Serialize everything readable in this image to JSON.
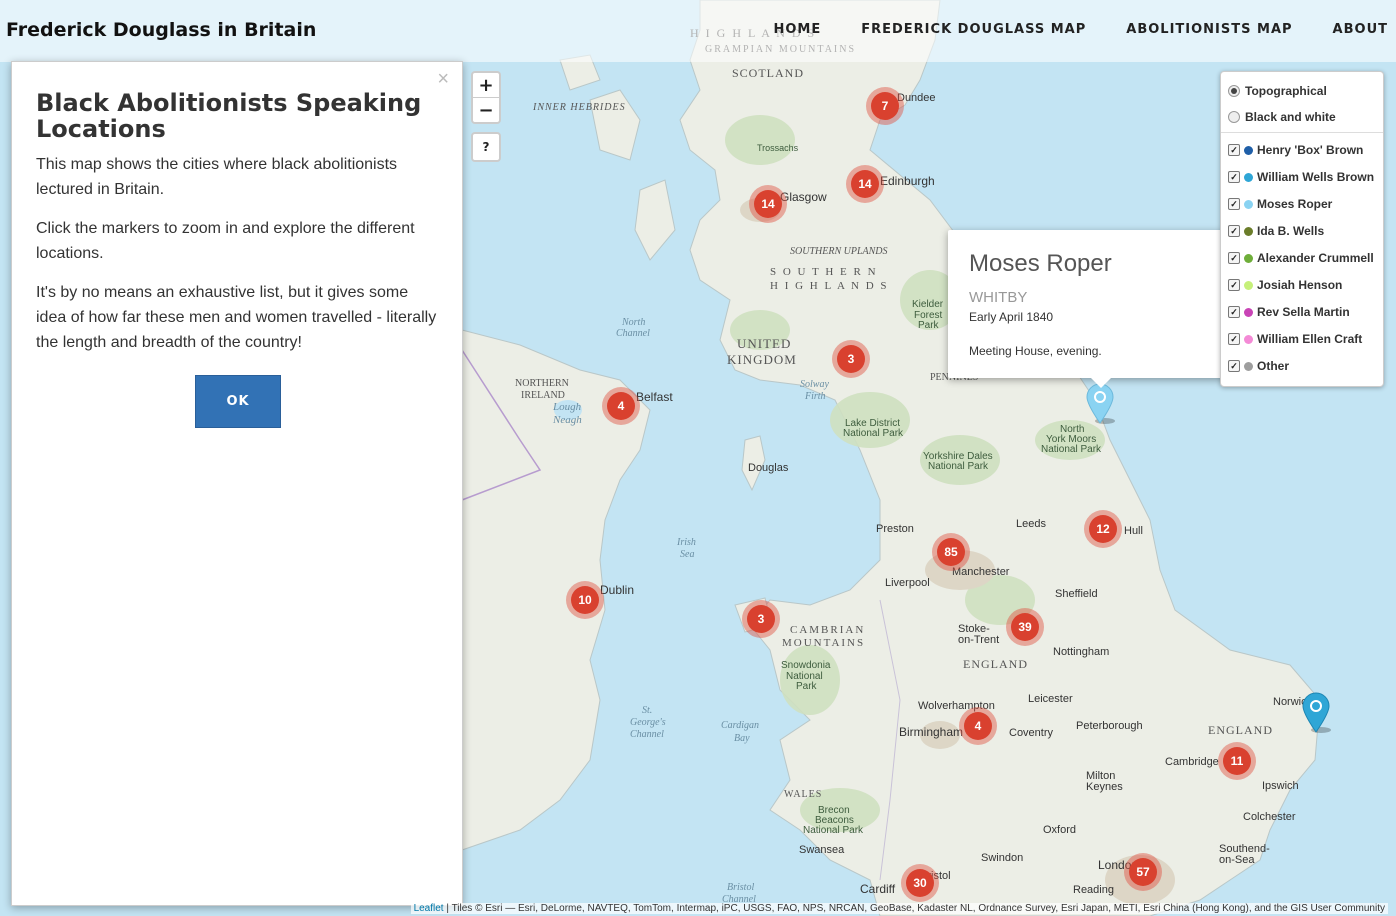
{
  "navbar": {
    "brand": "Frederick Douglass in Britain",
    "items": [
      "HOME",
      "FREDERICK DOUGLASS MAP",
      "ABOLITIONISTS MAP",
      "ABOUT"
    ]
  },
  "info_panel": {
    "title": "Black Abolitionists Speaking Locations",
    "paragraphs": [
      "This map shows the cities where black abolitionists lectured in Britain.",
      "Click the markers to zoom in and explore the different locations.",
      "It's by no means an exhaustive list, but it gives some idea of how far these men and women travelled - literally the length and breadth of the country!"
    ],
    "ok_label": "OK",
    "close_symbol": "×"
  },
  "zoom": {
    "in": "+",
    "out": "−",
    "help": "?"
  },
  "popup": {
    "name": "Moses Roper",
    "place": "WHITBY",
    "date": "Early April 1840",
    "description": "Meeting House, evening."
  },
  "layers": {
    "basemaps": [
      {
        "label": "Topographical",
        "selected": true
      },
      {
        "label": "Black and white",
        "selected": false
      }
    ],
    "overlays": [
      {
        "label": "Henry 'Box' Brown",
        "color": "#1f5fa8",
        "checked": true
      },
      {
        "label": "William Wells Brown",
        "color": "#2fa6d6",
        "checked": true
      },
      {
        "label": "Moses Roper",
        "color": "#8ad3f2",
        "checked": true
      },
      {
        "label": "Ida B. Wells",
        "color": "#6b7d2a",
        "checked": true
      },
      {
        "label": "Alexander Crummell",
        "color": "#6fae3a",
        "checked": true
      },
      {
        "label": "Josiah Henson",
        "color": "#c6f07a",
        "checked": true
      },
      {
        "label": "Rev Sella Martin",
        "color": "#c944b6",
        "checked": true
      },
      {
        "label": "William Ellen Craft",
        "color": "#f48ad6",
        "checked": true
      },
      {
        "label": "Other",
        "color": "#9e9e9e",
        "checked": true
      }
    ]
  },
  "clusters": [
    "7",
    "14",
    "14",
    "3",
    "4",
    "10",
    "3",
    "85",
    "12",
    "39",
    "4",
    "11",
    "57",
    "30"
  ],
  "map_labels": {
    "places": [
      "Dundee",
      "Edinburgh",
      "Glasgow",
      "Belfast",
      "Douglas",
      "Dublin",
      "Preston",
      "Leeds",
      "Hull",
      "Manchester",
      "Liverpool",
      "Sheffield",
      "Stoke-",
      "on-Trent",
      "Nottingham",
      "Leicester",
      "Wolverhampton",
      "Birmingham",
      "Coventry",
      "Peterborough",
      "Norwich",
      "Cambridge",
      "Ipswich",
      "Milton",
      "Keynes",
      "Colchester",
      "Oxford",
      "Swindon",
      "Bristol",
      "Cardiff",
      "Swansea",
      "London",
      "Reading",
      "Southend-",
      "on-Sea",
      "Trossachs"
    ],
    "regions": [
      "HIGHLANDS",
      "GRAMPIAN MOUNTAINS",
      "SCOTLAND",
      "SOUTHERN UPLANDS",
      "SOUTHERN",
      "HIGHLANDS",
      "UNITED",
      "KINGDOM",
      "NORTHERN",
      "IRELAND",
      "PENNINES",
      "CAMBRIAN",
      "MOUNTAINS",
      "ENGLAND",
      "ENGLAND",
      "WALES",
      "INNER HEBRIDES"
    ],
    "seas": [
      "North",
      "Channel",
      "Solway",
      "Firth",
      "Irish",
      "Sea",
      "St.",
      "George's",
      "Channel",
      "Cardigan",
      "Bay",
      "Bristol",
      "Channel",
      "Lough",
      "Neagh"
    ],
    "parks": [
      "Lake District",
      "National Park",
      "Yorkshire Dales",
      "National Park",
      "North",
      "York Moors",
      "National Park",
      "Kielder",
      "Forest",
      "Park",
      "Snowdonia",
      "National",
      "Park",
      "Brecon",
      "Beacons",
      "National Park"
    ]
  },
  "attribution": {
    "leaflet": "Leaflet",
    "text": " | Tiles © Esri — Esri, DeLorme, NAVTEQ, TomTom, Intermap, iPC, USGS, FAO, NPS, NRCAN, GeoBase, Kadaster NL, Ordnance Survey, Esri Japan, METI, Esri China (Hong Kong), and the GIS User Community"
  }
}
